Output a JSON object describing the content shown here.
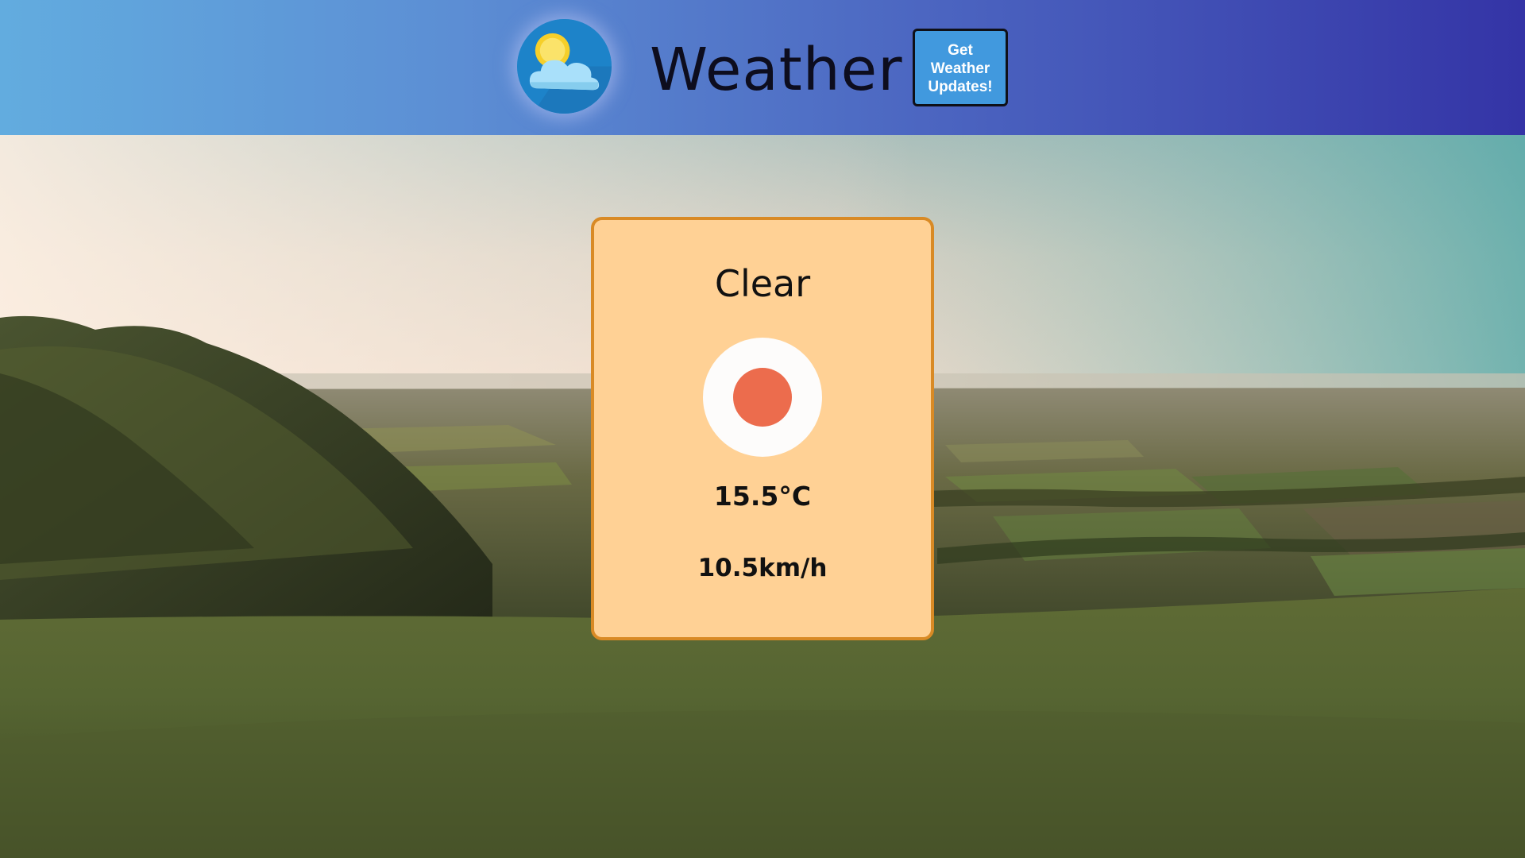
{
  "header": {
    "logo_icon": "sun-behind-cloud-icon",
    "title": "Weather",
    "updates_button_label": "Get Weather Updates!"
  },
  "background": {
    "description_icon": "landscape-hills-photo"
  },
  "weather_card": {
    "condition": "Clear",
    "condition_icon": "clear-sun-dot-icon",
    "temperature": "15.5°C",
    "wind_speed": "10.5km/h"
  },
  "colors": {
    "header_gradient_start": "#62acdf",
    "header_gradient_end": "#3434a6",
    "button_bg": "#4199de",
    "card_bg": "#ffd195",
    "card_border": "#d98a25",
    "sun_dot": "#ec6c4d"
  }
}
